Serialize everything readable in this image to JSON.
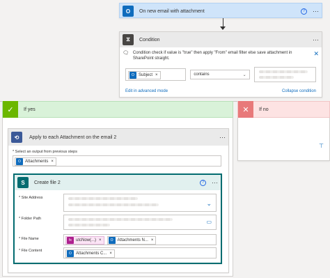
{
  "trigger": {
    "title": "On new email with attachment"
  },
  "condition": {
    "title": "Condition",
    "note": "Condition check if value is \"true\" then apply \"From\" email filter else save attachment in SharePoint straight.",
    "left_token": "Subject",
    "operator": "contains",
    "edit_advanced": "Edit in advanced mode",
    "collapse": "Collapse condition"
  },
  "branches": {
    "yes": "If yes",
    "no": "If no"
  },
  "apply_each": {
    "title": "Apply to each Attachment on the email 2",
    "select_label": "* Select an output from previous steps",
    "token": "Attachments"
  },
  "create_file": {
    "title": "Create file 2",
    "site_label": "* Site Address",
    "folder_label": "* Folder Path",
    "name_label": "* File Name",
    "content_label": "* File Content",
    "name_tokens": [
      "utcNow(...)",
      "Attachments N..."
    ],
    "content_token": "Attachments C..."
  },
  "colors": {
    "trigger_bg": "#cfe4fa",
    "yes_bg": "#d9f2d9",
    "no_bg": "#fde3e3",
    "accent": "#0f6cbd"
  },
  "icons": [
    "outlook-icon",
    "condition-icon",
    "loop-icon",
    "sharepoint-icon",
    "function-icon",
    "check-icon",
    "close-icon",
    "help-icon",
    "chevron-down-icon",
    "folder-icon",
    "insert-step-icon"
  ]
}
